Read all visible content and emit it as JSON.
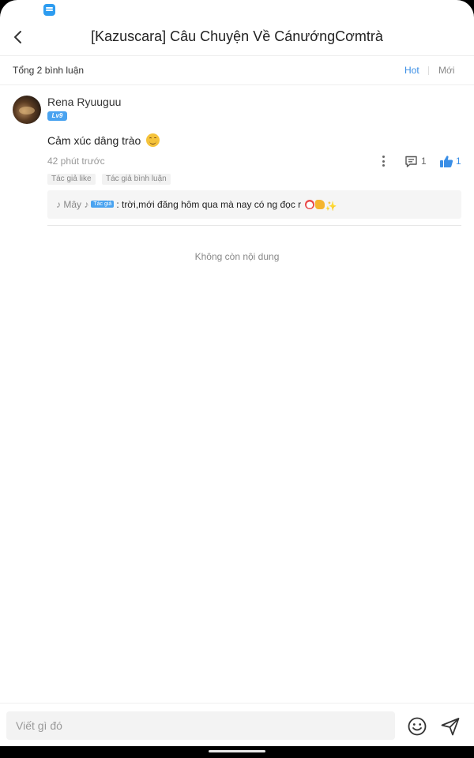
{
  "header": {
    "title": "[Kazuscara] Câu Chuyện Về CánướngCơmtrà"
  },
  "comments_bar": {
    "total_label": "Tổng 2 bình luận",
    "sort_hot": "Hot",
    "sort_new": "Mới"
  },
  "comment": {
    "username": "Rena Ryuuguu",
    "level": "Lv9",
    "text": "Cảm xúc dâng trào",
    "time": "42 phút trước",
    "reply_count": "1",
    "like_count": "1",
    "tags": [
      "Tác giả like",
      "Tác giả bình luận"
    ],
    "reply": {
      "author": "♪ Mây ♪",
      "author_badge": "Tác giả",
      "text": ": trời,mới đăng hôm qua mà nay có ng đọc r"
    }
  },
  "end_label": "Không còn nội dung",
  "input": {
    "placeholder": "Viết gì đó"
  },
  "colors": {
    "accent": "#3a8ee6",
    "badge": "#4aa3f0"
  }
}
